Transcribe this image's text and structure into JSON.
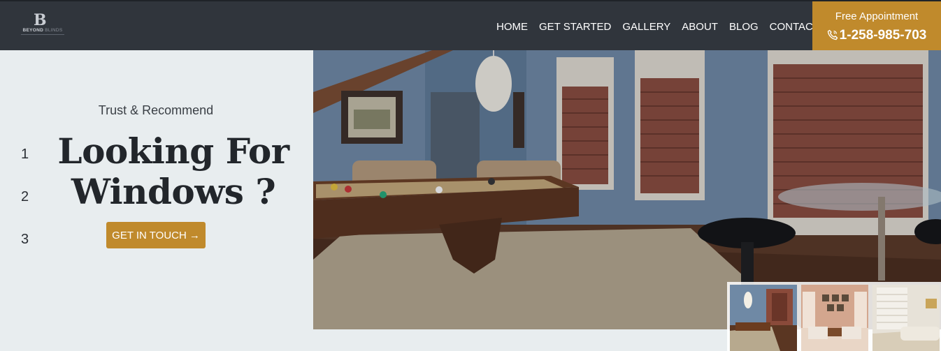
{
  "brand": {
    "mark": "B",
    "name_primary": "BEYOND",
    "name_secondary": "BLINDS"
  },
  "nav": {
    "items": [
      "HOME",
      "GET STARTED",
      "GALLERY",
      "ABOUT",
      "BLOG",
      "CONTACT"
    ]
  },
  "appointment": {
    "title": "Free Appointment",
    "phone": "1-258-985-703"
  },
  "hero": {
    "eyebrow": "Trust & Recommend",
    "headline_line1": "Looking For",
    "headline_line2": "Windows ?",
    "cta_label": "GET IN TOUCH",
    "cta_arrow": "→"
  },
  "slides": {
    "numbers": [
      "1",
      "2",
      "3"
    ]
  },
  "colors": {
    "header_bg": "#30353c",
    "accent": "#c08a2c",
    "page_bg": "#e8edef",
    "headline": "#22262b"
  },
  "icons": {
    "phone": "phone-icon",
    "arrow": "arrow-right-icon"
  }
}
